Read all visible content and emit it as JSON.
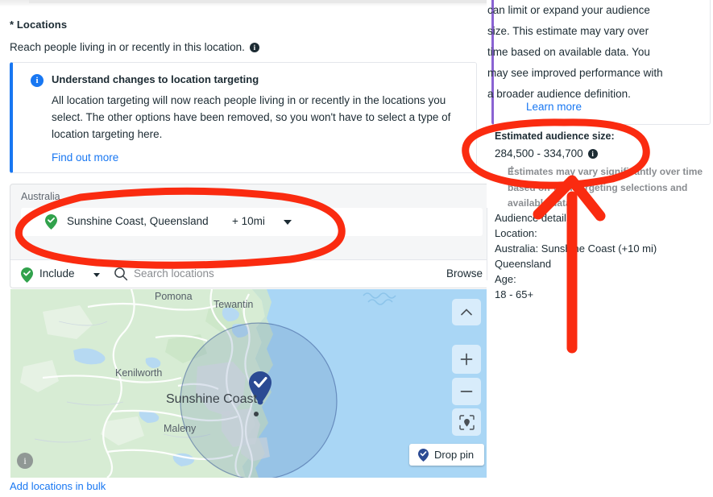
{
  "form": {
    "section_title": "* Locations",
    "section_subtitle": "Reach people living in or recently in this location.",
    "info_glyph": "i"
  },
  "notice": {
    "icon": "info-icon",
    "title": "Understand changes to location targeting",
    "body": "All location targeting will now reach people living in or recently in the locations you select. The other options have been removed, so you won't have to select a type of location targeting here.",
    "link": "Find out more",
    "accent_color": "#1877f2"
  },
  "locations": {
    "country_group": "Australia",
    "chip": {
      "label": "Sunshine Coast, Queensland",
      "radius": "+ 10mi",
      "pin_color": "#31a24c"
    },
    "include_label": "Include",
    "search_placeholder": "Search locations",
    "browse_label": "Browse",
    "bulk_link": "Add locations in bulk"
  },
  "map": {
    "labels": {
      "pomona": "Pomona",
      "tewantin": "Tewantin",
      "kenilworth": "Kenilworth",
      "maleny": "Maleny",
      "sunshine_coast": "Sunshine Coast"
    },
    "controls": {
      "collapse": "^",
      "zoom_in": "+",
      "zoom_out": "−",
      "locate": "locate-icon"
    },
    "drop_pin_label": "Drop pin",
    "info_glyph": "i",
    "land_color": "#d7ecd4",
    "water_color": "#a9d6f5",
    "radius_circle_color": "#3b5998",
    "pin_color": "#2b4a93"
  },
  "right_panel": {
    "tip_text": "can limit or expand your audience size. This estimate may vary over time based on available data. You may see improved performance with a broader audience definition.",
    "tip_link": "Learn more",
    "tip_accent_color": "#8a63d2",
    "estimate_title": "Estimated audience size:",
    "estimate_value": "284,500 - 334,700",
    "estimate_note": "Estimates may vary significantly over time based on your targeting selections and available data.",
    "estimate_note_mark": "†",
    "audience_details": {
      "heading": "Audience details",
      "location_label": "Location:",
      "location_value": "Australia: Sunshine Coast (+10 mi) Queensland",
      "age_label": "Age:",
      "age_value": "18 - 65+"
    }
  },
  "annotations": {
    "color": "#fa2b10",
    "ellipse_left": "highlight around selected location chip",
    "ellipse_right": "highlight around estimated audience size",
    "arrow": "arrow pointing up to estimated audience size"
  }
}
